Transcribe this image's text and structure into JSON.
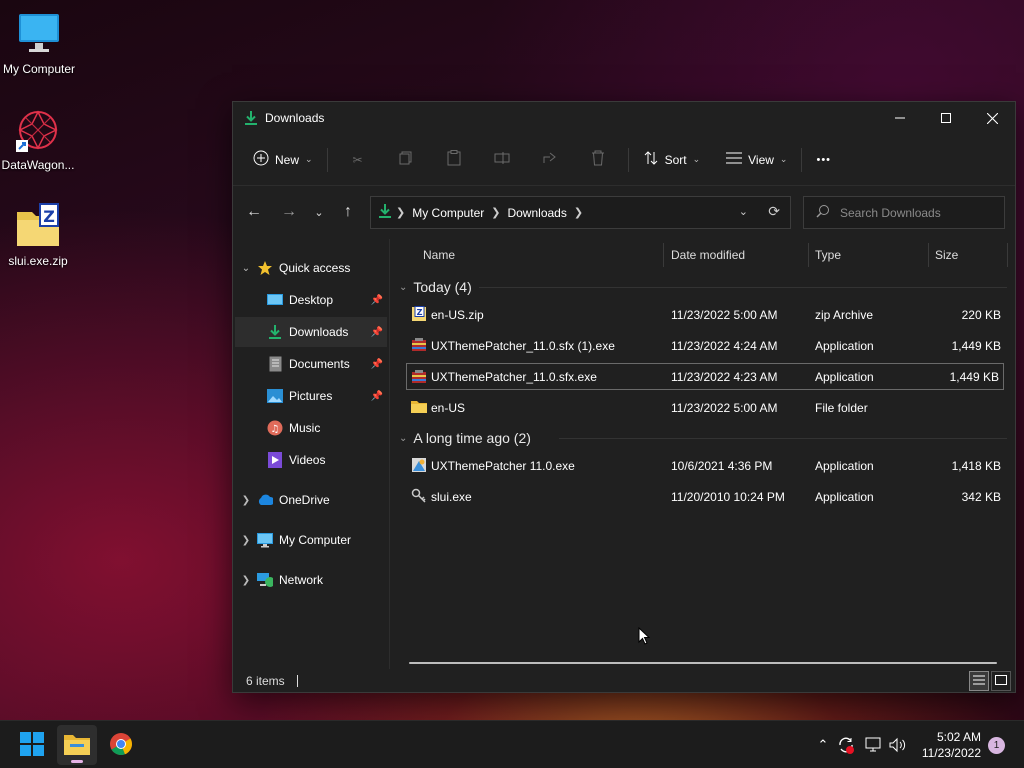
{
  "desktop": {
    "icons": [
      {
        "label": "My Computer",
        "icon": "monitor-icon"
      },
      {
        "label": "DataWagon...",
        "icon": "datawagon-app-icon"
      },
      {
        "label": "slui.exe.zip",
        "icon": "zip-archive-icon"
      }
    ]
  },
  "window": {
    "title": "Downloads",
    "commands": {
      "new_label": "New",
      "sort_label": "Sort",
      "view_label": "View",
      "more_label": "•••"
    },
    "address": {
      "crumbs": [
        "My Computer",
        "Downloads"
      ]
    },
    "search": {
      "placeholder": "Search Downloads"
    },
    "sidebar": {
      "quick_access": "Quick access",
      "items": [
        {
          "label": "Desktop",
          "pinned": true
        },
        {
          "label": "Downloads",
          "pinned": true,
          "active": true
        },
        {
          "label": "Documents",
          "pinned": true
        },
        {
          "label": "Pictures",
          "pinned": true
        },
        {
          "label": "Music"
        },
        {
          "label": "Videos"
        }
      ],
      "onedrive": "OneDrive",
      "mycomputer": "My Computer",
      "network": "Network"
    },
    "columns": [
      "Name",
      "Date modified",
      "Type",
      "Size"
    ],
    "groups": [
      {
        "label": "Today (4)",
        "files": [
          {
            "name": "en-US.zip",
            "date": "11/23/2022 5:00 AM",
            "type": "zip Archive",
            "size": "220 KB",
            "icon": "zip-file-icon"
          },
          {
            "name": "UXThemePatcher_11.0.sfx (1).exe",
            "date": "11/23/2022 4:24 AM",
            "type": "Application",
            "size": "1,449 KB",
            "icon": "sfx-exe-icon"
          },
          {
            "name": "UXThemePatcher_11.0.sfx.exe",
            "date": "11/23/2022 4:23 AM",
            "type": "Application",
            "size": "1,449 KB",
            "icon": "sfx-exe-icon",
            "selected": true
          },
          {
            "name": "en-US",
            "date": "11/23/2022 5:00 AM",
            "type": "File folder",
            "size": "",
            "icon": "folder-icon"
          }
        ]
      },
      {
        "label": "A long time ago (2)",
        "files": [
          {
            "name": "UXThemePatcher 11.0.exe",
            "date": "10/6/2021 4:36 PM",
            "type": "Application",
            "size": "1,418 KB",
            "icon": "installer-exe-icon"
          },
          {
            "name": "slui.exe",
            "date": "11/20/2010 10:24 PM",
            "type": "Application",
            "size": "342 KB",
            "icon": "keys-exe-icon"
          }
        ]
      }
    ],
    "status": {
      "items": "6 items"
    }
  },
  "taskbar": {
    "time": "5:02 AM",
    "date": "11/23/2022",
    "notifications": "1"
  },
  "colors": {
    "accent_green": "#23b26d",
    "window_bg": "#202020",
    "taskbar_bg": "#1c1c1c"
  }
}
